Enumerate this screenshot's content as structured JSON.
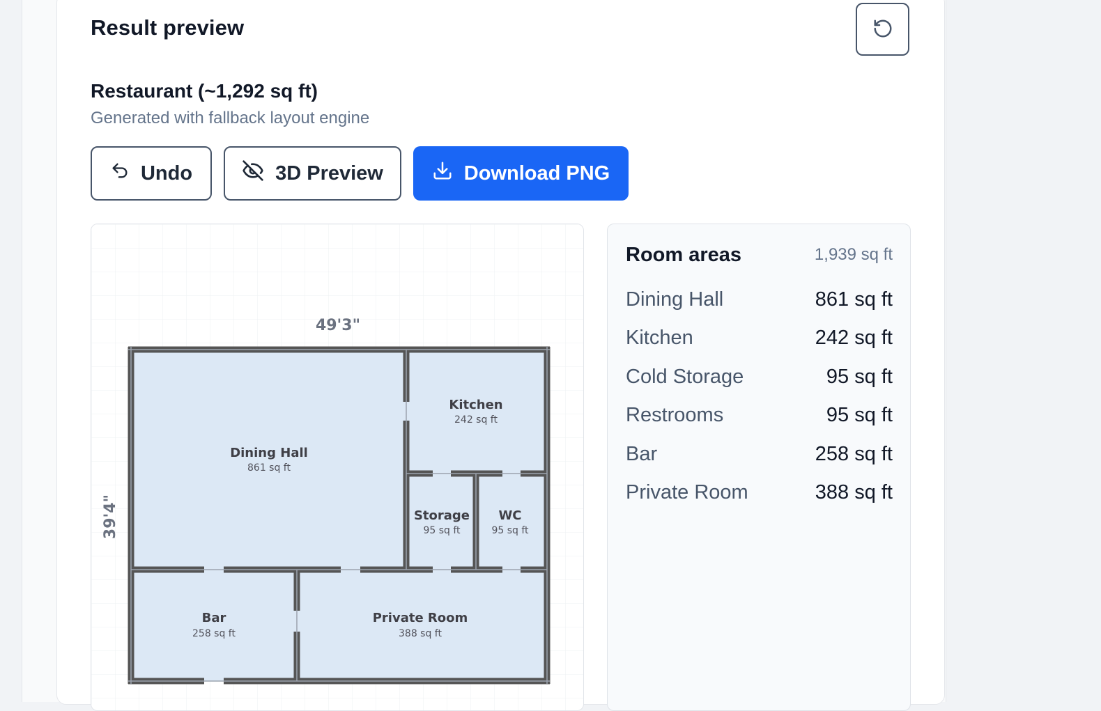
{
  "header": {
    "title": "Result preview",
    "refresh_icon": "refresh-icon"
  },
  "project": {
    "title": "Restaurant (~1,292 sq ft)",
    "subtitle": "Generated with fallback layout engine"
  },
  "actions": {
    "undo_label": "Undo",
    "undo_icon": "undo-icon",
    "preview3d_label": "3D Preview",
    "preview3d_icon": "eye-off-icon",
    "download_label": "Download PNG",
    "download_icon": "download-icon"
  },
  "floor_plan": {
    "width_label": "49'3\"",
    "height_label": "39'4\"",
    "rooms": [
      {
        "name": "Dining Hall",
        "area": "861 sq ft"
      },
      {
        "name": "Kitchen",
        "area": "242 sq ft"
      },
      {
        "name": "Storage",
        "area": "95 sq ft"
      },
      {
        "name": "WC",
        "area": "95 sq ft"
      },
      {
        "name": "Bar",
        "area": "258 sq ft"
      },
      {
        "name": "Private Room",
        "area": "388 sq ft"
      }
    ],
    "room_fill": "#dce8f5",
    "wall_color": "#555555"
  },
  "room_areas": {
    "title": "Room areas",
    "total": "1,939 sq ft",
    "items": [
      {
        "name": "Dining Hall",
        "value": "861 sq ft"
      },
      {
        "name": "Kitchen",
        "value": "242 sq ft"
      },
      {
        "name": "Cold Storage",
        "value": "95 sq ft"
      },
      {
        "name": "Restrooms",
        "value": "95 sq ft"
      },
      {
        "name": "Bar",
        "value": "258 sq ft"
      },
      {
        "name": "Private Room",
        "value": "388 sq ft"
      }
    ]
  },
  "colors": {
    "primary": "#1a66f5",
    "text": "#111827",
    "muted": "#64748b"
  }
}
